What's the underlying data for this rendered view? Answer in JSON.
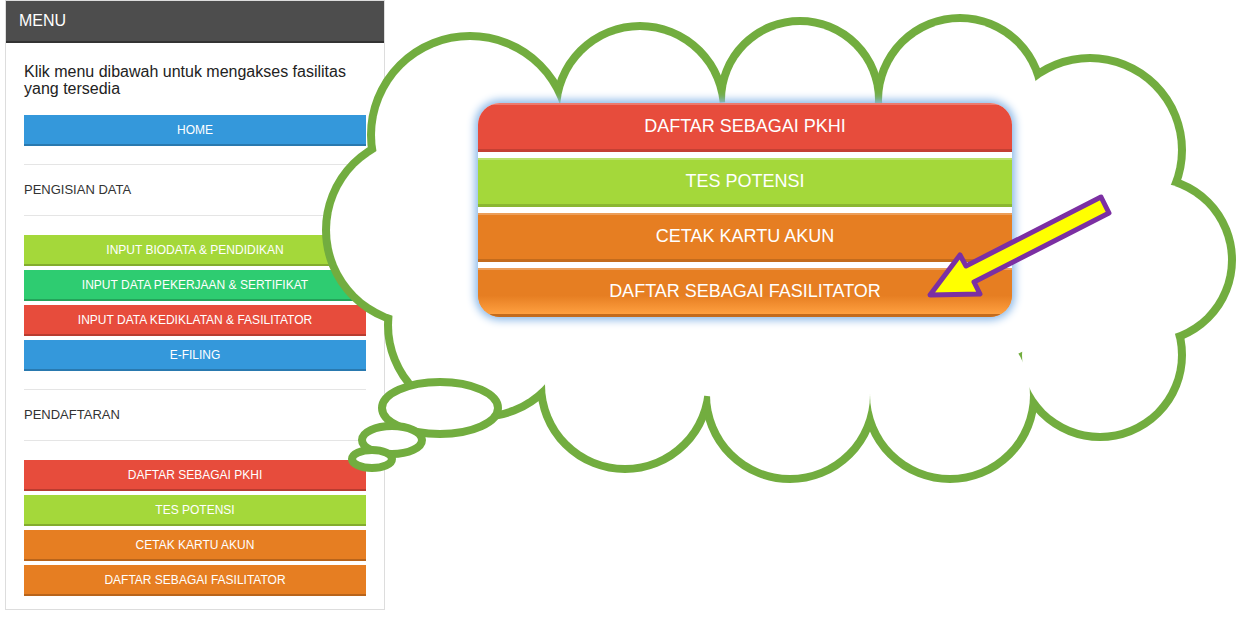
{
  "menu": {
    "title": "MENU",
    "intro": "Klik menu dibawah untuk mengakses fasilitas yang tersedia",
    "home": {
      "label": "HOME",
      "color": "#3498db"
    },
    "sections": [
      {
        "title": "PENGISIAN DATA",
        "items": [
          {
            "label": "INPUT BIODATA & PENDIDIKAN",
            "color": "#a4d83a"
          },
          {
            "label": "INPUT DATA PEKERJAAN & SERTIFIKAT",
            "color": "#2ecc71"
          },
          {
            "label": "INPUT DATA KEDIKLATAN & FASILITATOR",
            "color": "#e74c3c"
          },
          {
            "label": "E-FILING",
            "color": "#3498db"
          }
        ]
      },
      {
        "title": "PENDAFTARAN",
        "items": [
          {
            "label": "DAFTAR SEBAGAI PKHI",
            "color": "#e74c3c"
          },
          {
            "label": "TES POTENSI",
            "color": "#a4d83a"
          },
          {
            "label": "CETAK KARTU AKUN",
            "color": "#e67e22"
          },
          {
            "label": "DAFTAR SEBAGAI FASILITATOR",
            "color": "#e67e22"
          }
        ]
      }
    ]
  },
  "callout": {
    "items": [
      {
        "label": "DAFTAR SEBAGAI PKHI",
        "color": "#e74c3c",
        "pointed": false
      },
      {
        "label": "TES POTENSI",
        "color": "#a4d83a",
        "pointed": false
      },
      {
        "label": "CETAK KARTU AKUN",
        "color": "#e67e22",
        "pointed": false
      },
      {
        "label": "DAFTAR SEBAGAI FASILITATOR",
        "color": "#e67e22",
        "pointed": true
      }
    ]
  }
}
